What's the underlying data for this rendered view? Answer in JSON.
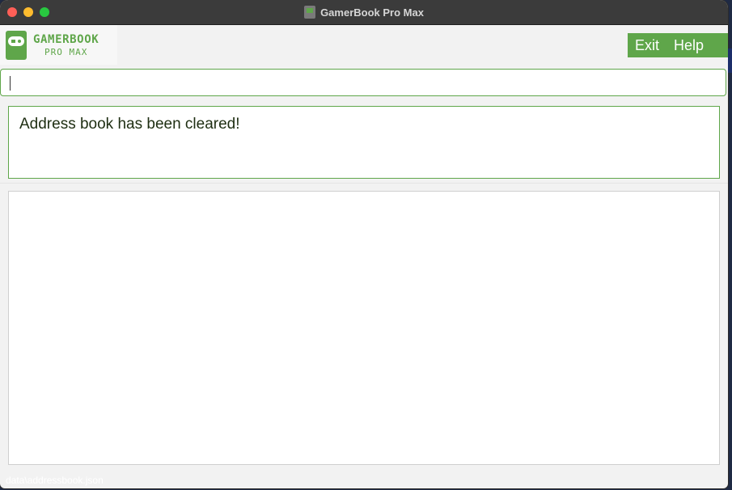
{
  "window": {
    "title": "GamerBook Pro Max"
  },
  "logo": {
    "line1": "GAMERBOOK",
    "line2": "PRO MAX"
  },
  "menu": {
    "items": [
      {
        "label": "Exit"
      },
      {
        "label": "Help"
      }
    ]
  },
  "command": {
    "value": ""
  },
  "result": {
    "text": "Address book has been cleared!"
  },
  "status": {
    "path": "data\\addressbook.json"
  },
  "colors": {
    "accent": "#5fa64a",
    "titlebar": "#3b3b3b"
  }
}
